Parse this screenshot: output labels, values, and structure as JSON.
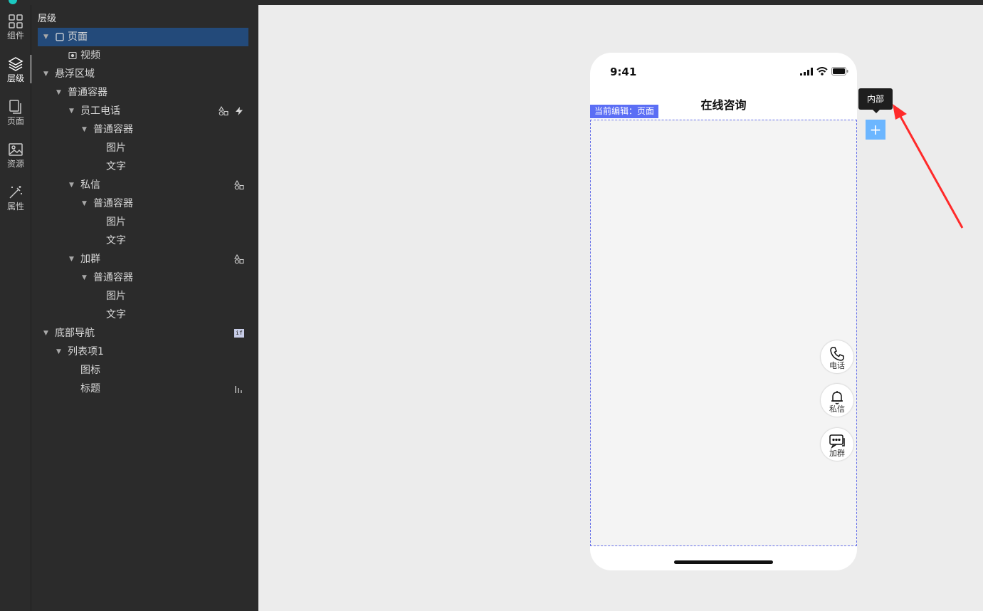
{
  "sidebar_rail": {
    "items": [
      {
        "label": "组件",
        "icon": "grid-icon"
      },
      {
        "label": "层级",
        "icon": "layers-icon"
      },
      {
        "label": "页面",
        "icon": "pages-icon"
      },
      {
        "label": "资源",
        "icon": "image-icon"
      },
      {
        "label": "属性",
        "icon": "magic-wand-icon"
      }
    ]
  },
  "panel": {
    "title": "层级",
    "tree": [
      {
        "label": "页面",
        "icon": "page-icon"
      },
      {
        "label": "视频",
        "icon": "video-icon"
      },
      {
        "label": "悬浮区域"
      },
      {
        "label": "普通容器"
      },
      {
        "label": "员工电话",
        "actions": [
          "shapes-icon",
          "lightning-icon"
        ]
      },
      {
        "label": "普通容器"
      },
      {
        "label": "图片"
      },
      {
        "label": "文字"
      },
      {
        "label": "私信",
        "actions": [
          "shapes-icon"
        ]
      },
      {
        "label": "普通容器"
      },
      {
        "label": "图片"
      },
      {
        "label": "文字"
      },
      {
        "label": "加群",
        "actions": [
          "shapes-icon"
        ]
      },
      {
        "label": "普通容器"
      },
      {
        "label": "图片"
      },
      {
        "label": "文字"
      },
      {
        "label": "底部导航",
        "actions": [
          "if-badge-icon"
        ],
        "badge": "if"
      },
      {
        "label": "列表项1"
      },
      {
        "label": "图标"
      },
      {
        "label": "标题",
        "actions": [
          "bar-chart-icon"
        ]
      }
    ]
  },
  "phone": {
    "time": "9:41",
    "title": "在线咨询",
    "edit_tag": "当前编辑：页面",
    "float_buttons": [
      {
        "label": "电话",
        "icon": "phone-icon"
      },
      {
        "label": "私信",
        "icon": "bell-icon"
      },
      {
        "label": "加群",
        "icon": "chat-icon"
      }
    ]
  },
  "tooltip": "内部",
  "add_button": "+",
  "colors": {
    "panel_bg": "#2b2b2b",
    "selected_row": "#234a7a",
    "edit_tag": "#5b6ef5",
    "add_button": "#6cb6ff",
    "arrow": "#ff2a2a"
  }
}
